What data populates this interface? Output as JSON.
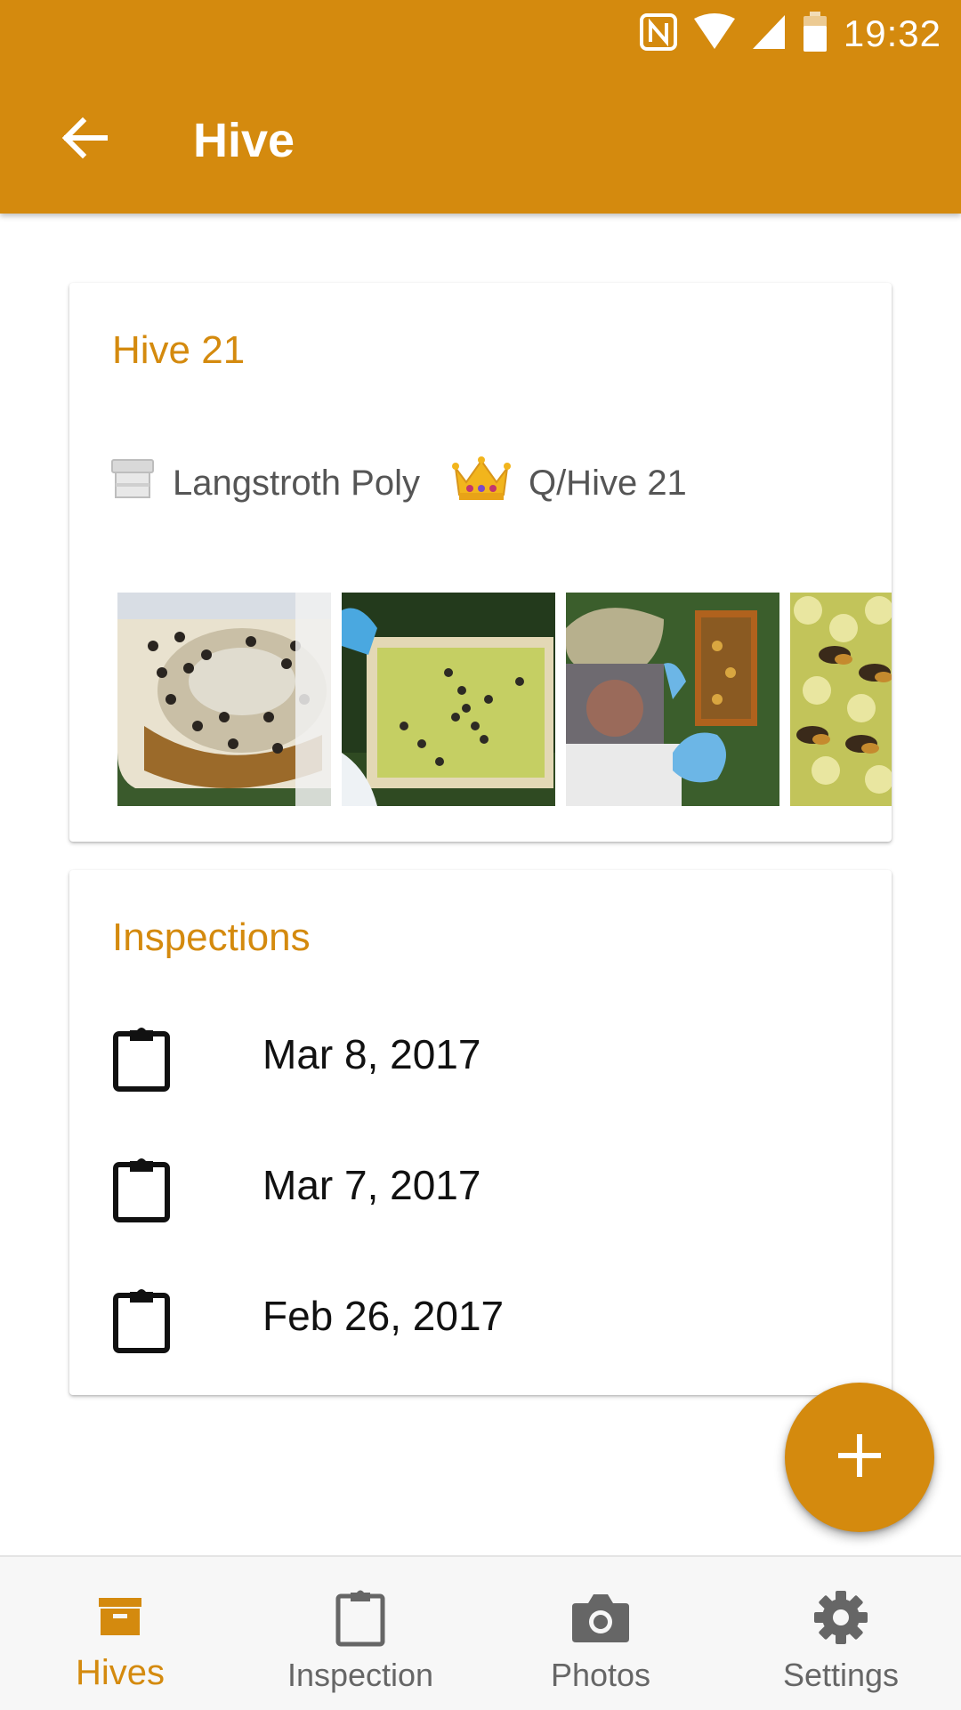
{
  "status_bar": {
    "time": "19:32"
  },
  "app_bar": {
    "title": "Hive"
  },
  "hive_card": {
    "name": "Hive 21",
    "hive_type": "Langstroth Poly",
    "queen": "Q/Hive 21",
    "photos": [
      "photo-frame-comb",
      "photo-empty-frame",
      "photo-beekeeper",
      "photo-bees-closeup"
    ]
  },
  "inspections_card": {
    "heading": "Inspections",
    "items": [
      {
        "date": "Mar 8, 2017"
      },
      {
        "date": "Mar 7, 2017"
      },
      {
        "date": "Feb 26, 2017"
      }
    ]
  },
  "fab": {
    "icon": "plus-icon"
  },
  "bottom_nav": {
    "items": [
      {
        "label": "Hives",
        "icon": "hive-box-icon",
        "active": true
      },
      {
        "label": "Inspection",
        "icon": "clipboard-icon",
        "active": false
      },
      {
        "label": "Photos",
        "icon": "camera-icon",
        "active": false
      },
      {
        "label": "Settings",
        "icon": "gear-icon",
        "active": false
      }
    ]
  },
  "colors": {
    "accent": "#d48a0e",
    "text_secondary": "#555555",
    "nav_inactive": "#666666"
  }
}
